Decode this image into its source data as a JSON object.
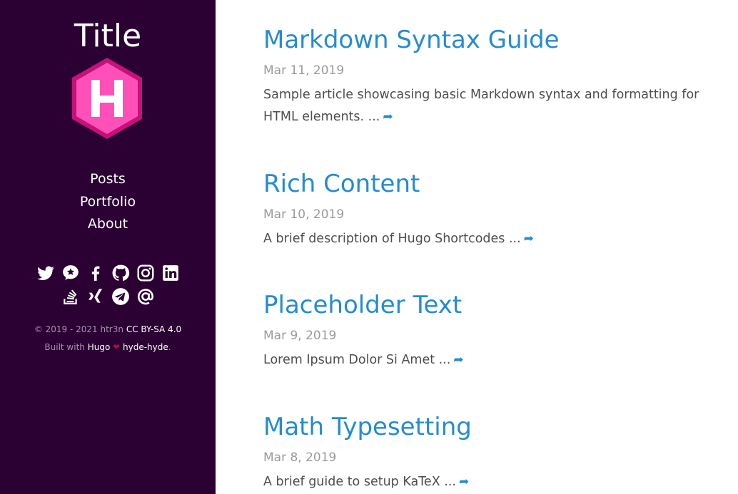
{
  "sidebar": {
    "title": "Title",
    "logo_letter": "H",
    "nav": [
      "Posts",
      "Portfolio",
      "About"
    ],
    "social_icons": [
      "twitter-icon",
      "micro-blog-icon",
      "facebook-icon",
      "github-icon",
      "instagram-icon",
      "linkedin-icon",
      "stackoverflow-icon",
      "xing-icon",
      "telegram-icon",
      "email-icon"
    ],
    "footer": {
      "copyright": "© 2019 - 2021 htr3n",
      "license": "CC BY-SA 4.0",
      "built_with": "Built with",
      "hugo": "Hugo",
      "theme": "hyde-hyde",
      "period": "."
    }
  },
  "posts": [
    {
      "title": "Markdown Syntax Guide",
      "date": "Mar 11, 2019",
      "summary": "Sample article showcasing basic Markdown syntax and formatting for HTML elements. ..."
    },
    {
      "title": "Rich Content",
      "date": "Mar 10, 2019",
      "summary": "A brief description of Hugo Shortcodes ..."
    },
    {
      "title": "Placeholder Text",
      "date": "Mar 9, 2019",
      "summary": "Lorem Ipsum Dolor Si Amet ..."
    },
    {
      "title": "Math Typesetting",
      "date": "Mar 8, 2019",
      "summary": "A brief guide to setup KaTeX ..."
    }
  ],
  "colors": {
    "sidebar_bg": "#2b0033",
    "link": "#268bd2",
    "logo_magenta": "#e91e8c"
  }
}
